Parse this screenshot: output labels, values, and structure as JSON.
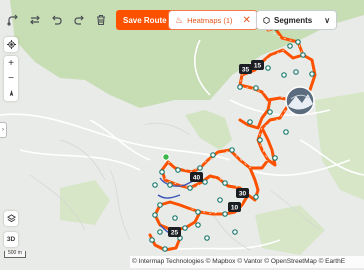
{
  "toolbar": {
    "save_label": "Save Route",
    "icons": [
      "route-icon",
      "swap-icon",
      "undo-icon",
      "redo-icon",
      "trash-icon"
    ]
  },
  "heatmaps": {
    "label": "Heatmaps (1)"
  },
  "segments": {
    "label": "Segments"
  },
  "controls": {
    "zoom_in": "+",
    "zoom_out": "−",
    "layers_3d": "3D"
  },
  "scale": {
    "label": "500 m"
  },
  "attribution": {
    "text": "© Intermap Technologies © Mapbox © Vantor © OpenStreetMap © EarthE"
  },
  "markers": [
    {
      "label": "35"
    },
    {
      "label": "15"
    },
    {
      "label": "40"
    },
    {
      "label": "30"
    },
    {
      "label": "10"
    },
    {
      "label": "25"
    }
  ],
  "colors": {
    "route": "#fc5200",
    "brand": "#fc5200",
    "forest": "#c9deb6",
    "map_bg": "#e9ebe8",
    "marker": "#1b1e22"
  }
}
